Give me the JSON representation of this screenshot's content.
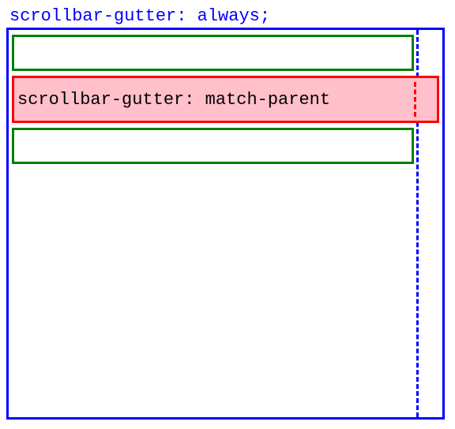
{
  "heading": "scrollbar-gutter: always;",
  "redBoxLabel": "scrollbar-gutter: match-parent"
}
